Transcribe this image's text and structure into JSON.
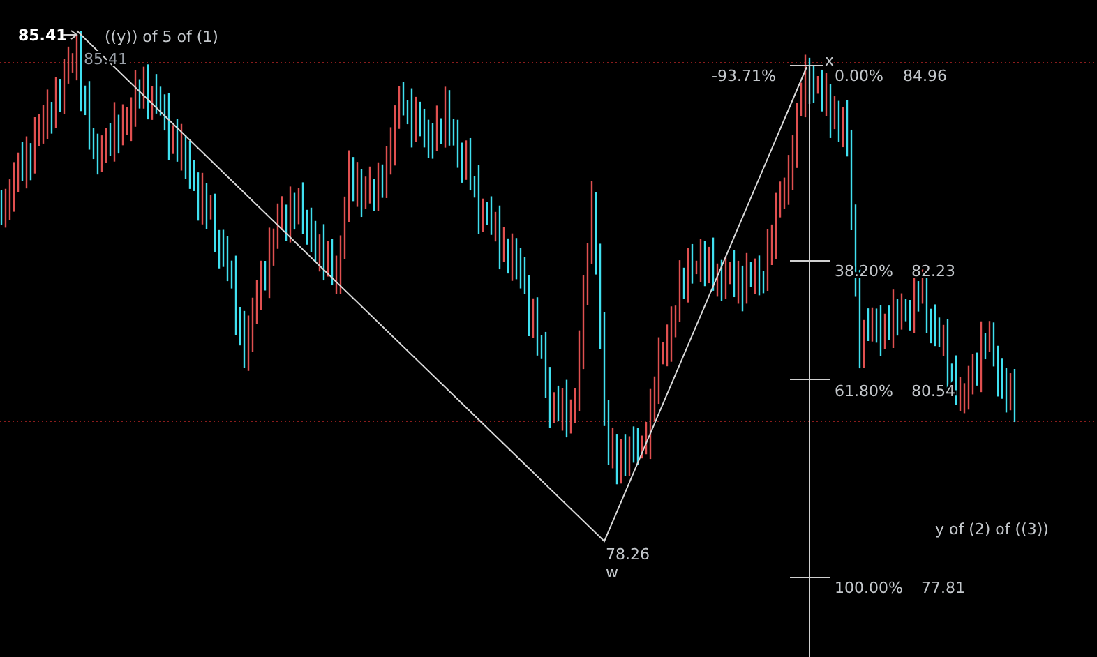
{
  "wave": {
    "start_price": "85.41",
    "start_mark": "85.41",
    "start_wave": "((y)) of 5 of (1)",
    "low_price": "78.26",
    "low_wave": "w",
    "high_wave": "x",
    "retrace": "-93.71%",
    "target_wave": "y of (2) of ((3))"
  },
  "fib_levels": [
    {
      "percent": "0.00%",
      "price": "84.96"
    },
    {
      "percent": "38.20%",
      "price": "82.23"
    },
    {
      "percent": "61.80%",
      "price": "80.54"
    },
    {
      "percent": "100.00%",
      "price": "77.81"
    }
  ]
}
